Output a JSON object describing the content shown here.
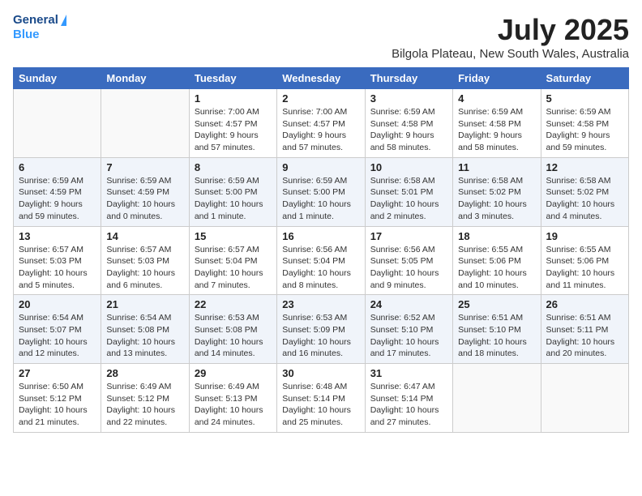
{
  "header": {
    "logo_line1": "General",
    "logo_line2": "Blue",
    "month_year": "July 2025",
    "location": "Bilgola Plateau, New South Wales, Australia"
  },
  "days_of_week": [
    "Sunday",
    "Monday",
    "Tuesday",
    "Wednesday",
    "Thursday",
    "Friday",
    "Saturday"
  ],
  "weeks": [
    [
      {
        "day": "",
        "info": ""
      },
      {
        "day": "",
        "info": ""
      },
      {
        "day": "1",
        "info": "Sunrise: 7:00 AM\nSunset: 4:57 PM\nDaylight: 9 hours and 57 minutes."
      },
      {
        "day": "2",
        "info": "Sunrise: 7:00 AM\nSunset: 4:57 PM\nDaylight: 9 hours and 57 minutes."
      },
      {
        "day": "3",
        "info": "Sunrise: 6:59 AM\nSunset: 4:58 PM\nDaylight: 9 hours and 58 minutes."
      },
      {
        "day": "4",
        "info": "Sunrise: 6:59 AM\nSunset: 4:58 PM\nDaylight: 9 hours and 58 minutes."
      },
      {
        "day": "5",
        "info": "Sunrise: 6:59 AM\nSunset: 4:58 PM\nDaylight: 9 hours and 59 minutes."
      }
    ],
    [
      {
        "day": "6",
        "info": "Sunrise: 6:59 AM\nSunset: 4:59 PM\nDaylight: 9 hours and 59 minutes."
      },
      {
        "day": "7",
        "info": "Sunrise: 6:59 AM\nSunset: 4:59 PM\nDaylight: 10 hours and 0 minutes."
      },
      {
        "day": "8",
        "info": "Sunrise: 6:59 AM\nSunset: 5:00 PM\nDaylight: 10 hours and 1 minute."
      },
      {
        "day": "9",
        "info": "Sunrise: 6:59 AM\nSunset: 5:00 PM\nDaylight: 10 hours and 1 minute."
      },
      {
        "day": "10",
        "info": "Sunrise: 6:58 AM\nSunset: 5:01 PM\nDaylight: 10 hours and 2 minutes."
      },
      {
        "day": "11",
        "info": "Sunrise: 6:58 AM\nSunset: 5:02 PM\nDaylight: 10 hours and 3 minutes."
      },
      {
        "day": "12",
        "info": "Sunrise: 6:58 AM\nSunset: 5:02 PM\nDaylight: 10 hours and 4 minutes."
      }
    ],
    [
      {
        "day": "13",
        "info": "Sunrise: 6:57 AM\nSunset: 5:03 PM\nDaylight: 10 hours and 5 minutes."
      },
      {
        "day": "14",
        "info": "Sunrise: 6:57 AM\nSunset: 5:03 PM\nDaylight: 10 hours and 6 minutes."
      },
      {
        "day": "15",
        "info": "Sunrise: 6:57 AM\nSunset: 5:04 PM\nDaylight: 10 hours and 7 minutes."
      },
      {
        "day": "16",
        "info": "Sunrise: 6:56 AM\nSunset: 5:04 PM\nDaylight: 10 hours and 8 minutes."
      },
      {
        "day": "17",
        "info": "Sunrise: 6:56 AM\nSunset: 5:05 PM\nDaylight: 10 hours and 9 minutes."
      },
      {
        "day": "18",
        "info": "Sunrise: 6:55 AM\nSunset: 5:06 PM\nDaylight: 10 hours and 10 minutes."
      },
      {
        "day": "19",
        "info": "Sunrise: 6:55 AM\nSunset: 5:06 PM\nDaylight: 10 hours and 11 minutes."
      }
    ],
    [
      {
        "day": "20",
        "info": "Sunrise: 6:54 AM\nSunset: 5:07 PM\nDaylight: 10 hours and 12 minutes."
      },
      {
        "day": "21",
        "info": "Sunrise: 6:54 AM\nSunset: 5:08 PM\nDaylight: 10 hours and 13 minutes."
      },
      {
        "day": "22",
        "info": "Sunrise: 6:53 AM\nSunset: 5:08 PM\nDaylight: 10 hours and 14 minutes."
      },
      {
        "day": "23",
        "info": "Sunrise: 6:53 AM\nSunset: 5:09 PM\nDaylight: 10 hours and 16 minutes."
      },
      {
        "day": "24",
        "info": "Sunrise: 6:52 AM\nSunset: 5:10 PM\nDaylight: 10 hours and 17 minutes."
      },
      {
        "day": "25",
        "info": "Sunrise: 6:51 AM\nSunset: 5:10 PM\nDaylight: 10 hours and 18 minutes."
      },
      {
        "day": "26",
        "info": "Sunrise: 6:51 AM\nSunset: 5:11 PM\nDaylight: 10 hours and 20 minutes."
      }
    ],
    [
      {
        "day": "27",
        "info": "Sunrise: 6:50 AM\nSunset: 5:12 PM\nDaylight: 10 hours and 21 minutes."
      },
      {
        "day": "28",
        "info": "Sunrise: 6:49 AM\nSunset: 5:12 PM\nDaylight: 10 hours and 22 minutes."
      },
      {
        "day": "29",
        "info": "Sunrise: 6:49 AM\nSunset: 5:13 PM\nDaylight: 10 hours and 24 minutes."
      },
      {
        "day": "30",
        "info": "Sunrise: 6:48 AM\nSunset: 5:14 PM\nDaylight: 10 hours and 25 minutes."
      },
      {
        "day": "31",
        "info": "Sunrise: 6:47 AM\nSunset: 5:14 PM\nDaylight: 10 hours and 27 minutes."
      },
      {
        "day": "",
        "info": ""
      },
      {
        "day": "",
        "info": ""
      }
    ]
  ]
}
